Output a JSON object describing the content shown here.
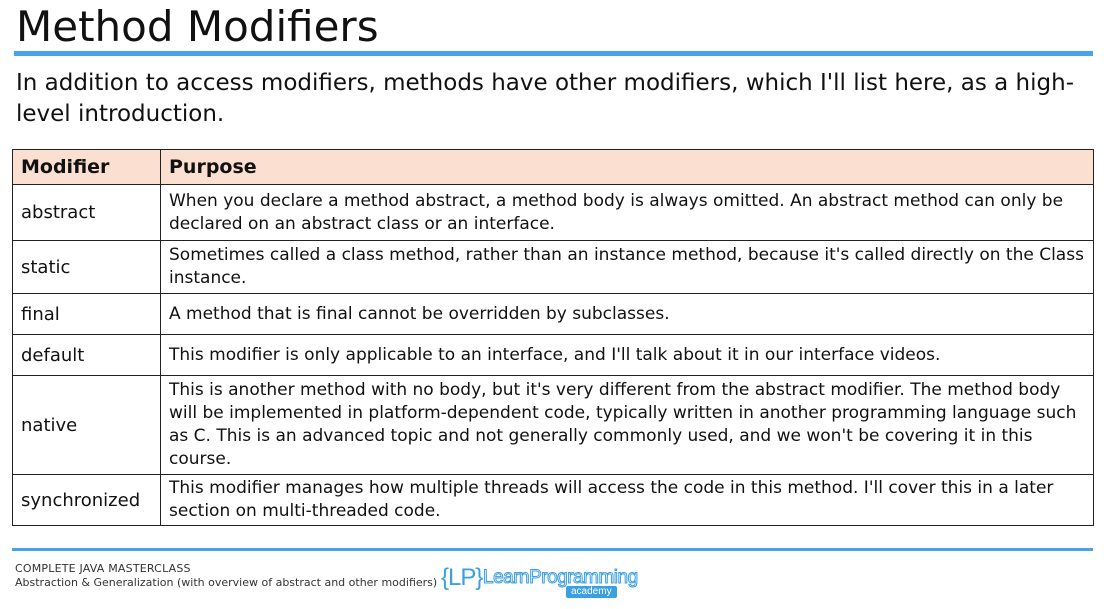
{
  "slide": {
    "title": "Method Modifiers",
    "intro": "In addition to access modifiers, methods have other modifiers, which I'll list here, as a high-level introduction."
  },
  "table": {
    "headers": [
      "Modifier",
      "Purpose"
    ],
    "rows": [
      {
        "modifier": "abstract",
        "purpose": "When you declare a method abstract, a method body is always omitted. An abstract method can only be declared on an abstract class or an interface."
      },
      {
        "modifier": "static",
        "purpose": "Sometimes called a class method, rather than an instance method, because it's called directly on the Class instance."
      },
      {
        "modifier": "final",
        "purpose": "A method that is final cannot be overridden by subclasses."
      },
      {
        "modifier": "default",
        "purpose": "This modifier is only applicable to an interface, and I'll talk about it in our interface videos."
      },
      {
        "modifier": "native",
        "purpose": "This is another method with no body, but it's very different from the abstract modifier.  The method body will be implemented in platform-dependent code, typically written in another programming language such as C.  This is an advanced topic and not generally commonly used, and we won't be covering it in this course."
      },
      {
        "modifier": "synchronized",
        "purpose": "This modifier manages how multiple threads will access the code in this method.  I'll cover this in a later section on multi-threaded code."
      }
    ]
  },
  "footer": {
    "course": "COMPLETE JAVA MASTERCLASS",
    "subtitle": "Abstraction & Generalization (with overview of abstract and other modifiers)",
    "logo": {
      "mark": "{LP}",
      "name": "LearnProgramming",
      "tag": "academy"
    }
  },
  "colors": {
    "accent_rule": "#4aa3e8",
    "header_fill": "#fbdfd1",
    "logo_blue": "#3aa0e0"
  }
}
